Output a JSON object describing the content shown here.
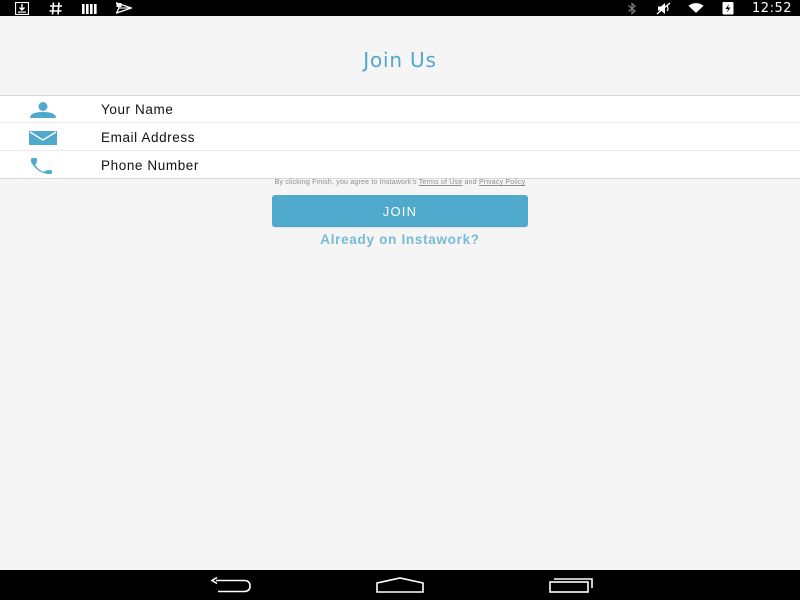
{
  "status_bar": {
    "time": "12:52",
    "left_icons": [
      "download-icon",
      "hash-icon",
      "signal-bars-icon",
      "send-icon"
    ],
    "right_icons": [
      "bluetooth-icon",
      "mute-icon",
      "wifi-icon",
      "battery-icon"
    ]
  },
  "header": {
    "title": "Join Us"
  },
  "form": {
    "name_placeholder": "Your Name",
    "email_placeholder": "Email Address",
    "phone_placeholder": "Phone Number",
    "name_icon": "person-icon",
    "email_icon": "envelope-icon",
    "phone_icon": "phone-icon"
  },
  "terms": {
    "prefix": "By clicking Finish, you agree to Instawork's ",
    "terms_link": "Terms of Use",
    "conjunction": " and ",
    "privacy_link": "Privacy Policy"
  },
  "join_button_label": "JOIN",
  "login_link_label": "Already on Instawork?",
  "nav_bar": {
    "icons": [
      "back-icon",
      "home-icon",
      "recents-icon"
    ]
  },
  "colors": {
    "accent": "#4ea9cd",
    "link": "#76bcd6",
    "title": "#4fa8cb",
    "status_bar": "#000000"
  }
}
